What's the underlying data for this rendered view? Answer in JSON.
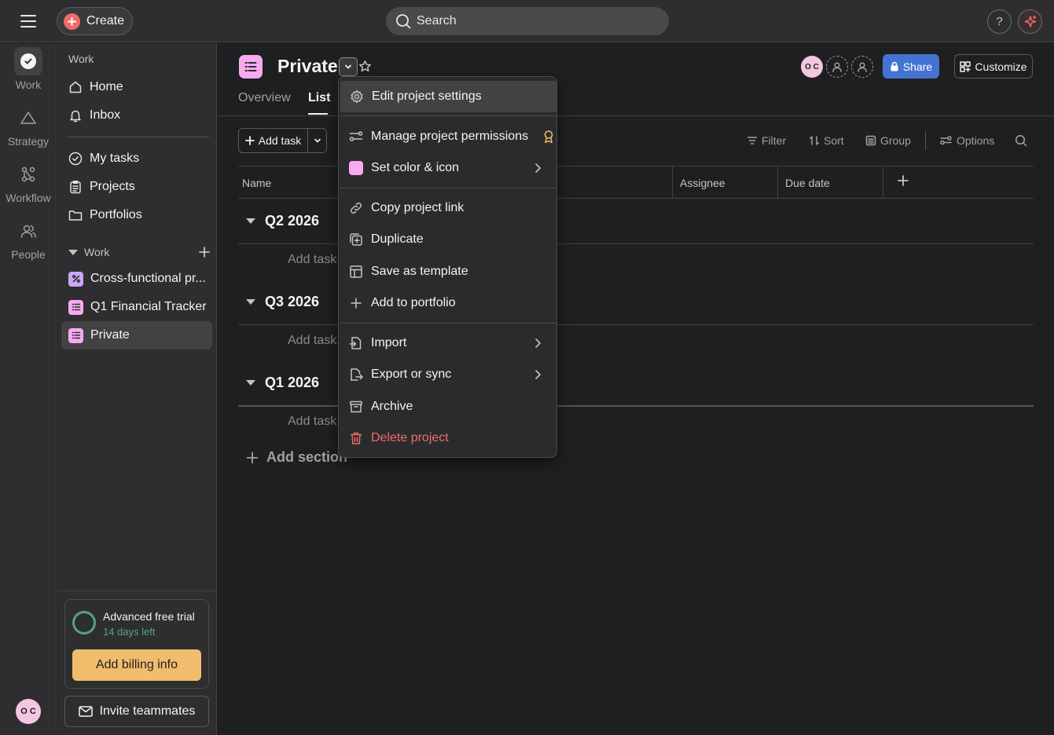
{
  "topbar": {
    "create_label": "Create",
    "search_placeholder": "Search",
    "help_label": "?"
  },
  "rail": {
    "items": [
      {
        "label": "Work",
        "icon": "check-circle-icon"
      },
      {
        "label": "Strategy",
        "icon": "triangle-icon"
      },
      {
        "label": "Workflow",
        "icon": "workflow-icon"
      },
      {
        "label": "People",
        "icon": "people-icon"
      }
    ],
    "avatar_initials": "O C"
  },
  "sidebar": {
    "heading": "Work",
    "nav": [
      "Home",
      "Inbox"
    ],
    "personal": [
      "My tasks",
      "Projects",
      "Portfolios"
    ],
    "section_label": "Work",
    "projects": [
      {
        "label": "Cross-functional pr...",
        "color": "#c9a7f5"
      },
      {
        "label": "Q1 Financial Tracker",
        "color": "#f9aaef"
      },
      {
        "label": "Private",
        "color": "#f9aaef"
      }
    ],
    "trial": {
      "title": "Advanced free trial",
      "days_left": "14 days left",
      "billing_label": "Add billing info"
    },
    "invite_label": "Invite teammates"
  },
  "project": {
    "title": "Private",
    "tabs": [
      "Overview",
      "List"
    ],
    "avatar_initials": "O C",
    "share_label": "Share",
    "customize_label": "Customize"
  },
  "toolbar": {
    "add_task_label": "Add task",
    "filter_label": "Filter",
    "sort_label": "Sort",
    "group_label": "Group",
    "options_label": "Options"
  },
  "list": {
    "columns": [
      "Name",
      "Assignee",
      "Due date"
    ],
    "sections": [
      "Q2 2026",
      "Q3 2026",
      "Q1 2026"
    ],
    "add_task_placeholder": "Add task...",
    "add_section_label": "Add section"
  },
  "menu": {
    "items": [
      "Edit project settings",
      "Manage project permissions",
      "Set color & icon",
      "Copy project link",
      "Duplicate",
      "Save as template",
      "Add to portfolio",
      "Import",
      "Export or sync",
      "Archive",
      "Delete project"
    ]
  },
  "colors": {
    "accent_blue": "#4573d2",
    "brand_coral": "#f06a6a",
    "trial_green": "#58a182",
    "billing_orange": "#f1bd6c",
    "project_pink": "#f9aaef"
  }
}
